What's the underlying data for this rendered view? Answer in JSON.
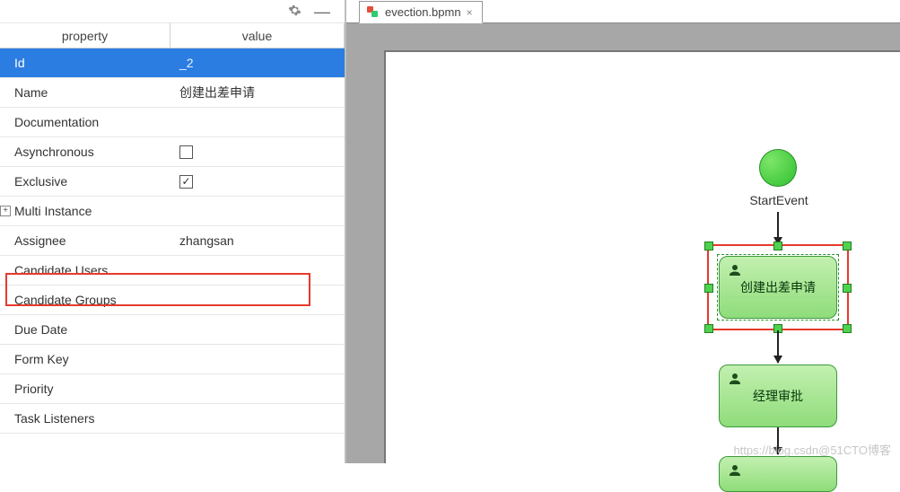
{
  "tab": {
    "title": "evection.bpmn"
  },
  "columns": {
    "property": "property",
    "value": "value"
  },
  "rows": [
    {
      "key": "id",
      "label": "Id",
      "value": "_2",
      "selected": true
    },
    {
      "key": "name",
      "label": "Name",
      "value": "创建出差申请"
    },
    {
      "key": "documentation",
      "label": "Documentation",
      "value": ""
    },
    {
      "key": "asynchronous",
      "label": "Asynchronous",
      "checkbox": true,
      "checked": false
    },
    {
      "key": "exclusive",
      "label": "Exclusive",
      "checkbox": true,
      "checked": true
    },
    {
      "key": "multi_instance",
      "label": "Multi Instance",
      "value": "",
      "expandable": true
    },
    {
      "key": "assignee",
      "label": "Assignee",
      "value": "zhangsan",
      "highlighted": true
    },
    {
      "key": "candidate_users",
      "label": "Candidate Users",
      "value": ""
    },
    {
      "key": "candidate_groups",
      "label": "Candidate Groups",
      "value": ""
    },
    {
      "key": "due_date",
      "label": "Due Date",
      "value": ""
    },
    {
      "key": "form_key",
      "label": "Form Key",
      "value": ""
    },
    {
      "key": "priority",
      "label": "Priority",
      "value": ""
    },
    {
      "key": "task_listeners",
      "label": "Task Listeners",
      "value": ""
    }
  ],
  "diagram": {
    "start_label": "StartEvent",
    "task1_label": "创建出差申请",
    "task2_label": "经理审批"
  },
  "watermark": "https://blog.csdn@51CTO博客"
}
